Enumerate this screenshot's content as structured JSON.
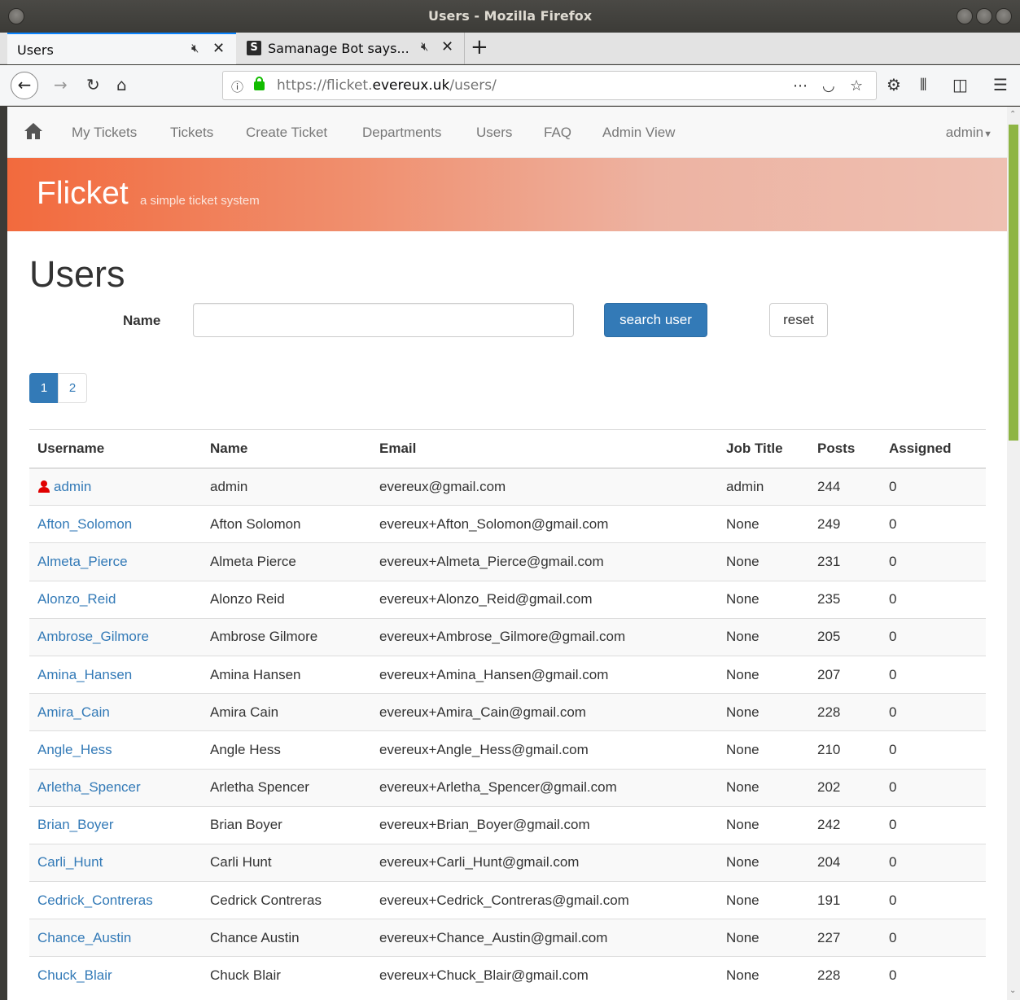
{
  "window": {
    "title": "Users - Mozilla Firefox"
  },
  "tabs": [
    {
      "label": "Users",
      "active": true
    },
    {
      "label": "Samanage Bot says...",
      "favicon": "S",
      "active": false
    }
  ],
  "toolbar": {
    "url_prefix": "https://flicket.",
    "url_domain": "evereux.uk",
    "url_path": "/users/"
  },
  "navbar": {
    "links": [
      "My Tickets",
      "Tickets",
      "Create Ticket",
      "Departments",
      "Users",
      "FAQ",
      "Admin View"
    ],
    "user_menu": "admin"
  },
  "banner": {
    "brand": "Flicket",
    "tagline": "a simple ticket system"
  },
  "page": {
    "heading": "Users",
    "search": {
      "label": "Name",
      "value": "",
      "search_button": "search user",
      "reset_button": "reset"
    },
    "pagination": [
      "1",
      "2"
    ],
    "current_page": "1"
  },
  "table": {
    "headers": [
      "Username",
      "Name",
      "Email",
      "Job Title",
      "Posts",
      "Assigned"
    ],
    "rows": [
      {
        "username": "admin",
        "name": "admin",
        "email": "evereux@gmail.com",
        "job": "admin",
        "posts": "244",
        "assigned": "0",
        "is_admin": true
      },
      {
        "username": "Afton_Solomon",
        "name": "Afton Solomon",
        "email": "evereux+Afton_Solomon@gmail.com",
        "job": "None",
        "posts": "249",
        "assigned": "0"
      },
      {
        "username": "Almeta_Pierce",
        "name": "Almeta Pierce",
        "email": "evereux+Almeta_Pierce@gmail.com",
        "job": "None",
        "posts": "231",
        "assigned": "0"
      },
      {
        "username": "Alonzo_Reid",
        "name": "Alonzo Reid",
        "email": "evereux+Alonzo_Reid@gmail.com",
        "job": "None",
        "posts": "235",
        "assigned": "0"
      },
      {
        "username": "Ambrose_Gilmore",
        "name": "Ambrose Gilmore",
        "email": "evereux+Ambrose_Gilmore@gmail.com",
        "job": "None",
        "posts": "205",
        "assigned": "0"
      },
      {
        "username": "Amina_Hansen",
        "name": "Amina Hansen",
        "email": "evereux+Amina_Hansen@gmail.com",
        "job": "None",
        "posts": "207",
        "assigned": "0"
      },
      {
        "username": "Amira_Cain",
        "name": "Amira Cain",
        "email": "evereux+Amira_Cain@gmail.com",
        "job": "None",
        "posts": "228",
        "assigned": "0"
      },
      {
        "username": "Angle_Hess",
        "name": "Angle Hess",
        "email": "evereux+Angle_Hess@gmail.com",
        "job": "None",
        "posts": "210",
        "assigned": "0"
      },
      {
        "username": "Arletha_Spencer",
        "name": "Arletha Spencer",
        "email": "evereux+Arletha_Spencer@gmail.com",
        "job": "None",
        "posts": "202",
        "assigned": "0"
      },
      {
        "username": "Brian_Boyer",
        "name": "Brian Boyer",
        "email": "evereux+Brian_Boyer@gmail.com",
        "job": "None",
        "posts": "242",
        "assigned": "0"
      },
      {
        "username": "Carli_Hunt",
        "name": "Carli Hunt",
        "email": "evereux+Carli_Hunt@gmail.com",
        "job": "None",
        "posts": "204",
        "assigned": "0"
      },
      {
        "username": "Cedrick_Contreras",
        "name": "Cedrick Contreras",
        "email": "evereux+Cedrick_Contreras@gmail.com",
        "job": "None",
        "posts": "191",
        "assigned": "0"
      },
      {
        "username": "Chance_Austin",
        "name": "Chance Austin",
        "email": "evereux+Chance_Austin@gmail.com",
        "job": "None",
        "posts": "227",
        "assigned": "0"
      },
      {
        "username": "Chuck_Blair",
        "name": "Chuck Blair",
        "email": "evereux+Chuck_Blair@gmail.com",
        "job": "None",
        "posts": "228",
        "assigned": "0"
      }
    ]
  },
  "colors": {
    "link": "#337ab7",
    "primary_button": "#337ab7",
    "banner_start": "#f26a3d",
    "banner_end": "#eec0b2",
    "admin_icon": "#e00000",
    "scrollbar_thumb": "#8eb544"
  },
  "icons": {
    "home": "home-icon",
    "admin_user": "user-icon",
    "tab_mute": "mute-icon"
  }
}
